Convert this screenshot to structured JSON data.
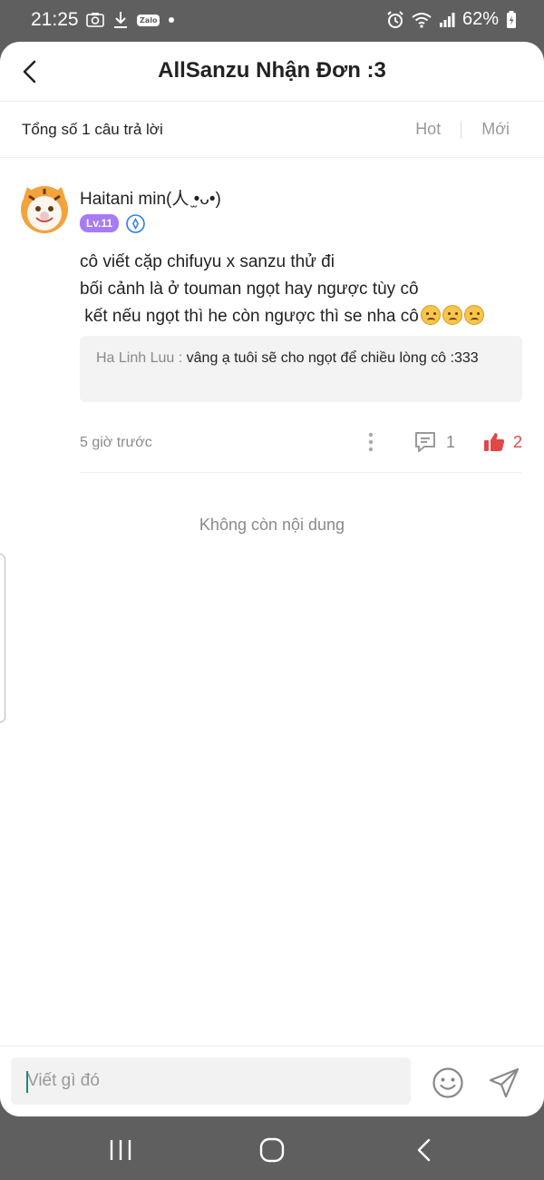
{
  "status_bar": {
    "time": "21:25",
    "zalo_label": "Zalo",
    "battery": "62%"
  },
  "header": {
    "title": "AllSanzu Nhận Đơn :3"
  },
  "summary": {
    "count_text": "Tổng số 1 câu trả lời",
    "sort_hot": "Hot",
    "sort_new": "Mới"
  },
  "comment": {
    "username": "Haitani min(人 ̫•ᴗ•)",
    "level": "Lv.11",
    "lines": [
      "cô viết cặp chifuyu x sanzu thử đi",
      "bối cảnh là ở touman ngọt hay ngược tùy cô",
      " kết nếu ngọt thì he còn ngược thì se nha cô"
    ],
    "emoji_count": 3,
    "reply_author": "Ha Linh Luu :",
    "reply_text": "vâng ạ tuôi sẽ cho ngọt để chiều lòng cô :333",
    "time": "5 giờ trước",
    "reply_count": "1",
    "like_count": "2"
  },
  "end_text": "Không còn nội dung",
  "composer": {
    "placeholder": "Viết gì đó"
  },
  "colors": {
    "level_badge": "#a77bf4",
    "like": "#e04848",
    "system_bar": "#5f5f5f"
  },
  "icons": [
    "camera-icon",
    "download-icon",
    "zalo-icon",
    "alarm-icon",
    "wifi-icon",
    "signal-icon",
    "battery-icon",
    "back-icon",
    "verified-badge-icon",
    "more-icon",
    "comment-icon",
    "like-icon",
    "emoji-icon",
    "send-icon",
    "recents-icon",
    "home-icon",
    "nav-back-icon"
  ]
}
